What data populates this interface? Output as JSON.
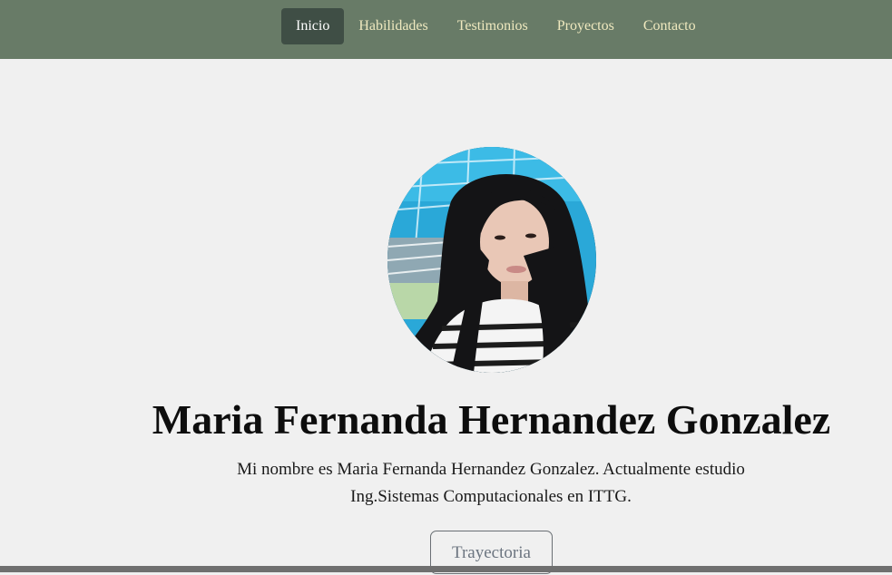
{
  "nav": {
    "items": [
      {
        "label": "Inicio",
        "active": true
      },
      {
        "label": "Habilidades",
        "active": false
      },
      {
        "label": "Testimonios",
        "active": false
      },
      {
        "label": "Proyectos",
        "active": false
      },
      {
        "label": "Contacto",
        "active": false
      }
    ]
  },
  "hero": {
    "name": "Maria Fernanda Hernandez Gonzalez",
    "intro_line1": "Mi nombre es Maria Fernanda Hernandez Gonzalez. Actualmente estudio",
    "intro_line2": "Ing.Sistemas Computacionales en ITTG.",
    "button_label": "Trayectoria"
  },
  "colors": {
    "navbar": "#687b67",
    "nav_active": "#3f4e45",
    "nav_text": "#efe9bf",
    "background": "#f0f0f0"
  }
}
